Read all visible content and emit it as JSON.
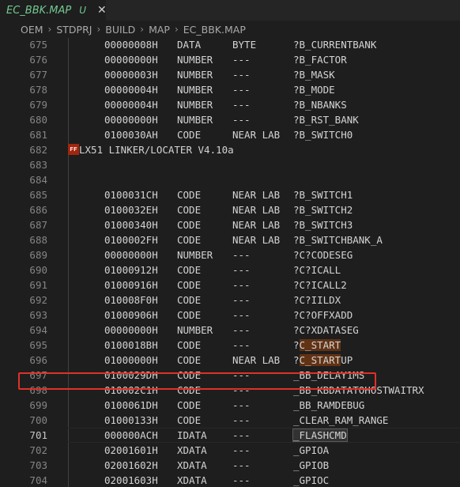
{
  "tab": {
    "title": "EC_BBK.MAP",
    "status": "U",
    "close": "✕"
  },
  "breadcrumb": [
    "OEM",
    "STDPRJ",
    "BUILD",
    "MAP",
    "EC_BBK.MAP"
  ],
  "breadcrumb_sep": "›",
  "ff_badge": "FF",
  "lines": [
    {
      "n": "675",
      "addr": "00000008H",
      "cls": "DATA",
      "type": "BYTE",
      "name": "?B_CURRENTBANK"
    },
    {
      "n": "676",
      "addr": "00000000H",
      "cls": "NUMBER",
      "type": "---",
      "name": "?B_FACTOR"
    },
    {
      "n": "677",
      "addr": "00000003H",
      "cls": "NUMBER",
      "type": "---",
      "name": "?B_MASK"
    },
    {
      "n": "678",
      "addr": "00000004H",
      "cls": "NUMBER",
      "type": "---",
      "name": "?B_MODE"
    },
    {
      "n": "679",
      "addr": "00000004H",
      "cls": "NUMBER",
      "type": "---",
      "name": "?B_NBANKS"
    },
    {
      "n": "680",
      "addr": "00000000H",
      "cls": "NUMBER",
      "type": "---",
      "name": "?B_RST_BANK"
    },
    {
      "n": "681",
      "addr": "0100030AH",
      "cls": "CODE",
      "type": "NEAR LAB",
      "name": "?B_SWITCH0"
    },
    {
      "n": "682",
      "text": "LX51 LINKER/LOCATER V4.10a",
      "ff": true
    },
    {
      "n": "683"
    },
    {
      "n": "684"
    },
    {
      "n": "685",
      "addr": "0100031CH",
      "cls": "CODE",
      "type": "NEAR LAB",
      "name": "?B_SWITCH1"
    },
    {
      "n": "686",
      "addr": "0100032EH",
      "cls": "CODE",
      "type": "NEAR LAB",
      "name": "?B_SWITCH2"
    },
    {
      "n": "687",
      "addr": "01000340H",
      "cls": "CODE",
      "type": "NEAR LAB",
      "name": "?B_SWITCH3"
    },
    {
      "n": "688",
      "addr": "0100002FH",
      "cls": "CODE",
      "type": "NEAR LAB",
      "name": "?B_SWITCHBANK_A"
    },
    {
      "n": "689",
      "addr": "00000000H",
      "cls": "NUMBER",
      "type": "---",
      "name": "?C?CODESEG"
    },
    {
      "n": "690",
      "addr": "01000912H",
      "cls": "CODE",
      "type": "---",
      "name": "?C?ICALL"
    },
    {
      "n": "691",
      "addr": "01000916H",
      "cls": "CODE",
      "type": "---",
      "name": "?C?ICALL2"
    },
    {
      "n": "692",
      "addr": "010008F0H",
      "cls": "CODE",
      "type": "---",
      "name": "?C?IILDX"
    },
    {
      "n": "693",
      "addr": "01000906H",
      "cls": "CODE",
      "type": "---",
      "name": "?C?OFFXADD"
    },
    {
      "n": "694",
      "addr": "00000000H",
      "cls": "NUMBER",
      "type": "---",
      "name": "?C?XDATASEG"
    },
    {
      "n": "695",
      "addr": "0100018BH",
      "cls": "CODE",
      "type": "---",
      "name_pre": "?",
      "name_hl": "C_START",
      "name_post": ""
    },
    {
      "n": "696",
      "addr": "01000000H",
      "cls": "CODE",
      "type": "NEAR LAB",
      "name_pre": "?",
      "name_hl": "C_START",
      "name_post": "UP"
    },
    {
      "n": "697",
      "addr": "0100029DH",
      "cls": "CODE",
      "type": "---",
      "name": "_BB_DELAY1MS"
    },
    {
      "n": "698",
      "addr": "010002C1H",
      "cls": "CODE",
      "type": "---",
      "name": "_BB_KBDATATOHOSTWAITRX"
    },
    {
      "n": "699",
      "addr": "0100061DH",
      "cls": "CODE",
      "type": "---",
      "name": "_BB_RAMDEBUG"
    },
    {
      "n": "700",
      "addr": "01000133H",
      "cls": "CODE",
      "type": "---",
      "name": "_CLEAR_RAM_RANGE"
    },
    {
      "n": "701",
      "addr": "000000ACH",
      "cls": "IDATA",
      "type": "---",
      "name_bracket": "_FLASHCMD",
      "current": true
    },
    {
      "n": "702",
      "addr": "02001601H",
      "cls": "XDATA",
      "type": "---",
      "name": "_GPIOA"
    },
    {
      "n": "703",
      "addr": "02001602H",
      "cls": "XDATA",
      "type": "---",
      "name": "_GPIOB"
    },
    {
      "n": "704",
      "addr": "02001603H",
      "cls": "XDATA",
      "type": "---",
      "name": "_GPIOC"
    }
  ]
}
